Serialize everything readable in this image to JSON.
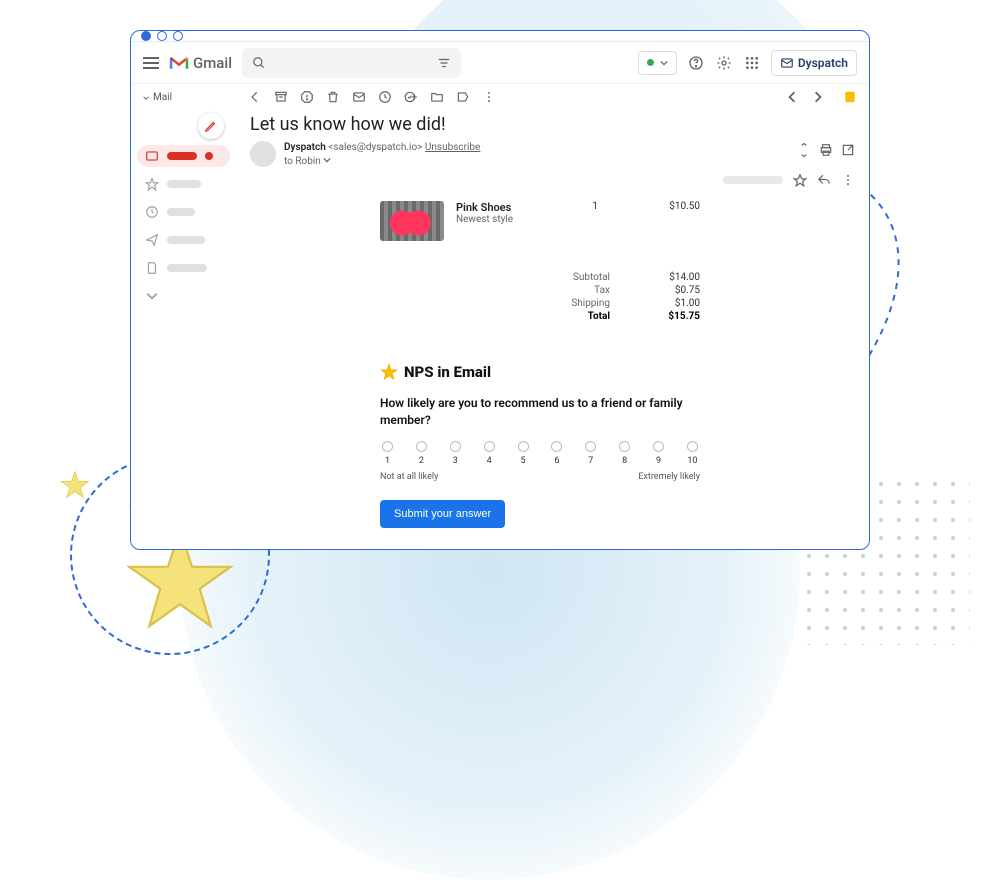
{
  "decor": {},
  "header": {
    "product_name": "Gmail",
    "search_placeholder": "",
    "dyspatch_label": "Dyspatch"
  },
  "sidebar": {
    "mail_label": "Mail"
  },
  "email": {
    "subject": "Let us know how we did!",
    "sender_name": "Dyspatch",
    "sender_email": "<sales@dyspatch.io>",
    "unsubscribe": "Unsubscribe",
    "to_line": "to Robin",
    "product": {
      "name": "Pink Shoes",
      "desc": "Newest style",
      "qty": "1",
      "price": "$10.50"
    },
    "totals": {
      "subtotal_label": "Subtotal",
      "subtotal": "$14.00",
      "tax_label": "Tax",
      "tax": "$0.75",
      "shipping_label": "Shipping",
      "shipping": "$1.00",
      "total_label": "Total",
      "total": "$15.75"
    },
    "nps": {
      "heading": "NPS in Email",
      "question": "How likely are you to recommend us to a friend or family member?",
      "options": [
        "1",
        "2",
        "3",
        "4",
        "5",
        "6",
        "7",
        "8",
        "9",
        "10"
      ],
      "low_label": "Not at all likely",
      "high_label": "Extremely likely",
      "submit": "Submit your answer"
    }
  }
}
